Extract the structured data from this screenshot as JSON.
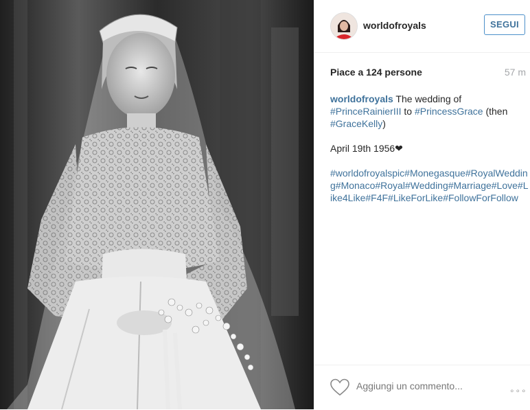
{
  "photo": {
    "alt_icon": "wedding-photo",
    "mode": "black-and-white"
  },
  "header": {
    "avatar_icon": "profile-avatar-icon",
    "username": "worldofroyals",
    "follow_label": "SEGUI"
  },
  "stats": {
    "likes": "Piace a 124 persone",
    "time": "57 m"
  },
  "caption": {
    "user": "worldofroyals",
    "text1": " The wedding of ",
    "tag1": "#PrinceRainierIII",
    "text2": " to ",
    "tag2": "#PrincessGrace",
    "text3": " (then ",
    "tag3": "#GraceKelly",
    "text4": ")",
    "date_line": "April 19th 1956❤",
    "hashtags": "#worldofroyalspic#Monegasque#RoyalWedding#Monaco#Royal#Wedding#Marriage#Love#Like4Like#F4F#LikeForLike#FollowForFollow"
  },
  "footer": {
    "like_icon": "heart-outline-icon",
    "comment_placeholder": "Aggiungi un commento...",
    "more_label": "∘∘∘",
    "more_icon": "more-options-icon"
  },
  "colors": {
    "link": "#3f729b",
    "muted": "#a5a7aa",
    "border": "#efefef"
  }
}
